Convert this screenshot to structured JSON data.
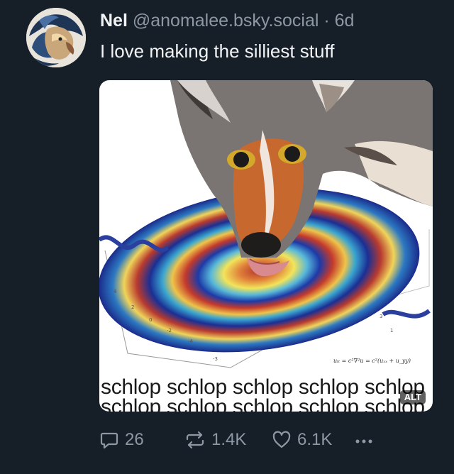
{
  "post": {
    "author": {
      "display_name": "Nel",
      "handle": "@anomalee.bsky.social",
      "separator": "·",
      "time": "6d",
      "avatar_icon": "avatar-illustration"
    },
    "text": "I love making the silliest stuff",
    "image": {
      "caption_line1": "schlop schlop schlop schlop schlop",
      "caption_line2": "schlop schlop schlop schlop schlop",
      "equation": "uₜₜ = c²∇²u = c²(uₓₓ + u_yy)",
      "alt_badge": "ALT"
    },
    "actions": {
      "reply_count": "26",
      "repost_count": "1.4K",
      "like_count": "6.1K",
      "more_icon": "more-icon"
    }
  },
  "colors": {
    "background": "#161e27",
    "text_primary": "#f1f3f5",
    "text_secondary": "#8d98a5"
  }
}
